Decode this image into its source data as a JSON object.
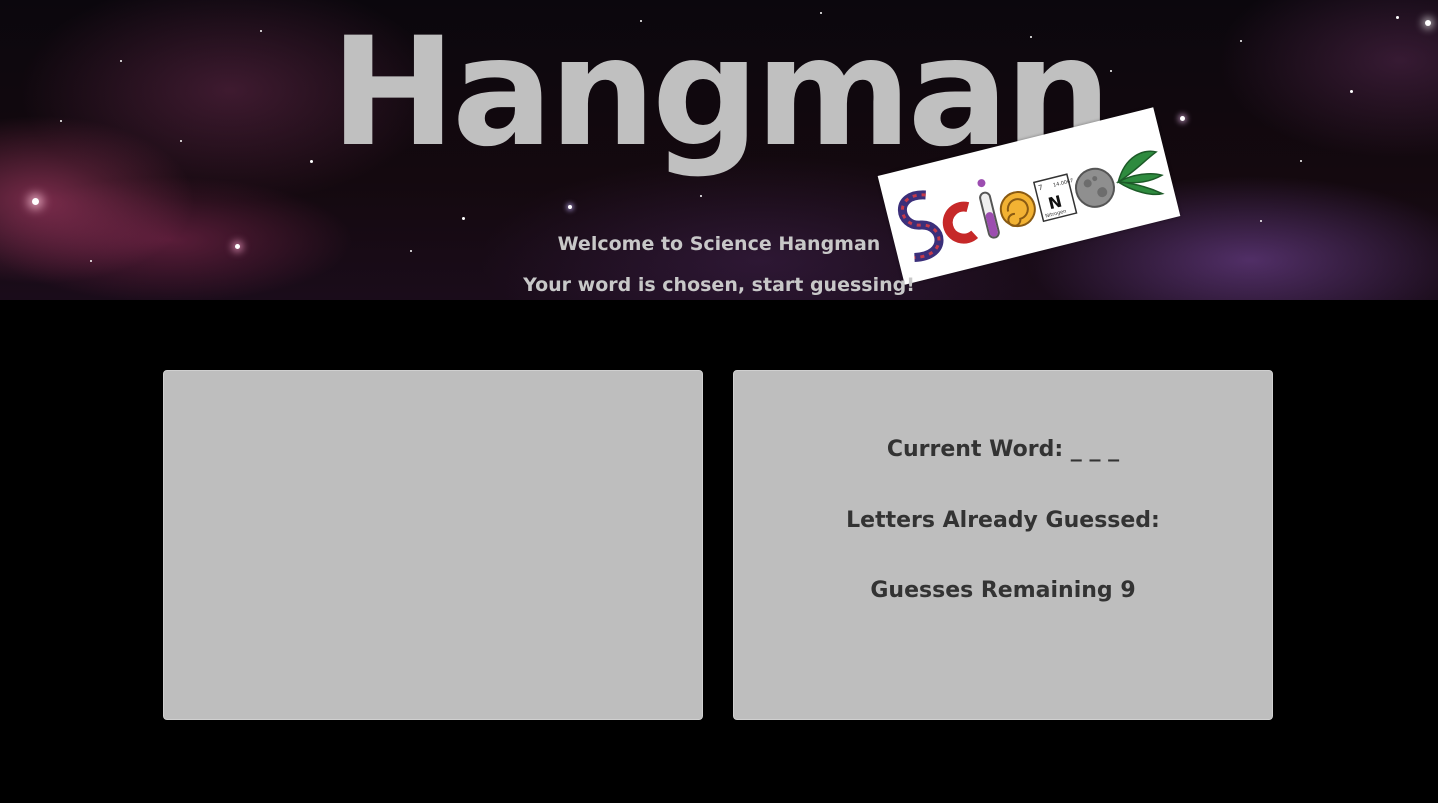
{
  "header": {
    "title": "Hangman",
    "welcome": "Welcome to Science Hangman",
    "status": "Your word is chosen, start guessing!",
    "logo_text": "SCIENCE",
    "logo_element_symbol": "N",
    "logo_element_name": "Nitrogen",
    "logo_element_number": "7",
    "logo_element_mass": "14.0067"
  },
  "game": {
    "current_word_label": "Current Word:",
    "current_word_value": "_ _ _",
    "letters_guessed_label": "Letters Already Guessed:",
    "letters_guessed_value": "",
    "guesses_remaining_label": "Guesses Remaining",
    "guesses_remaining_value": "9"
  },
  "colors": {
    "title": "#c0c0c0",
    "panel_background": "#bebebe",
    "panel_text": "#333333",
    "page_background": "#000000"
  }
}
